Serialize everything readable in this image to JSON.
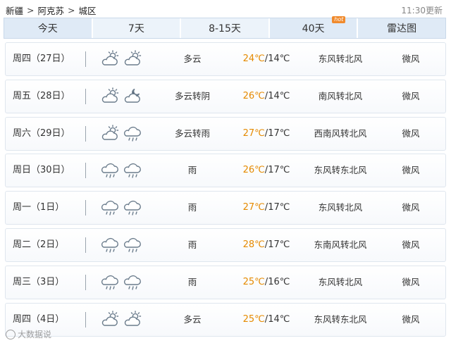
{
  "breadcrumb": {
    "region": "新疆",
    "city": "阿克苏",
    "district": "城区",
    "separator": ">"
  },
  "update_time": "11:30更新",
  "tabs": [
    {
      "label": "今天"
    },
    {
      "label": "7天"
    },
    {
      "label": "8-15天"
    },
    {
      "label": "40天",
      "badge": "hot"
    },
    {
      "label": "雷达图"
    }
  ],
  "forecast": [
    {
      "date": "周四（27日）",
      "icons": [
        "partly-cloudy-day-icon",
        "partly-cloudy-day-icon"
      ],
      "desc": "多云",
      "high": "24℃",
      "low": "14℃",
      "wind": "东风转北风",
      "level": "微风"
    },
    {
      "date": "周五（28日）",
      "icons": [
        "partly-cloudy-day-icon",
        "cloudy-night-icon"
      ],
      "desc": "多云转阴",
      "high": "26℃",
      "low": "14℃",
      "wind": "南风转北风",
      "level": "微风"
    },
    {
      "date": "周六（29日）",
      "icons": [
        "partly-cloudy-day-icon",
        "rain-icon"
      ],
      "desc": "多云转雨",
      "high": "27℃",
      "low": "17℃",
      "wind": "西南风转北风",
      "level": "微风"
    },
    {
      "date": "周日（30日）",
      "icons": [
        "rain-icon",
        "rain-icon"
      ],
      "desc": "雨",
      "high": "26℃",
      "low": "17℃",
      "wind": "东风转东北风",
      "level": "微风"
    },
    {
      "date": "周一（1日）",
      "icons": [
        "rain-icon",
        "rain-icon"
      ],
      "desc": "雨",
      "high": "27℃",
      "low": "17℃",
      "wind": "东风转北风",
      "level": "微风"
    },
    {
      "date": "周二（2日）",
      "icons": [
        "rain-icon",
        "rain-icon"
      ],
      "desc": "雨",
      "high": "28℃",
      "low": "17℃",
      "wind": "东南风转北风",
      "level": "微风"
    },
    {
      "date": "周三（3日）",
      "icons": [
        "rain-icon",
        "rain-icon"
      ],
      "desc": "雨",
      "high": "25℃",
      "low": "16℃",
      "wind": "东风转北风",
      "level": "微风"
    },
    {
      "date": "周四（4日）",
      "icons": [
        "partly-cloudy-day-icon",
        "partly-cloudy-day-icon"
      ],
      "desc": "多云",
      "high": "25℃",
      "low": "14℃",
      "wind": "东风转东北风",
      "level": "微风"
    }
  ],
  "colors": {
    "high_temp": "#e58a00",
    "tab_bg": "#dfeaf6",
    "hot_badge": "#f08a2c"
  },
  "watermark": "大数据说"
}
